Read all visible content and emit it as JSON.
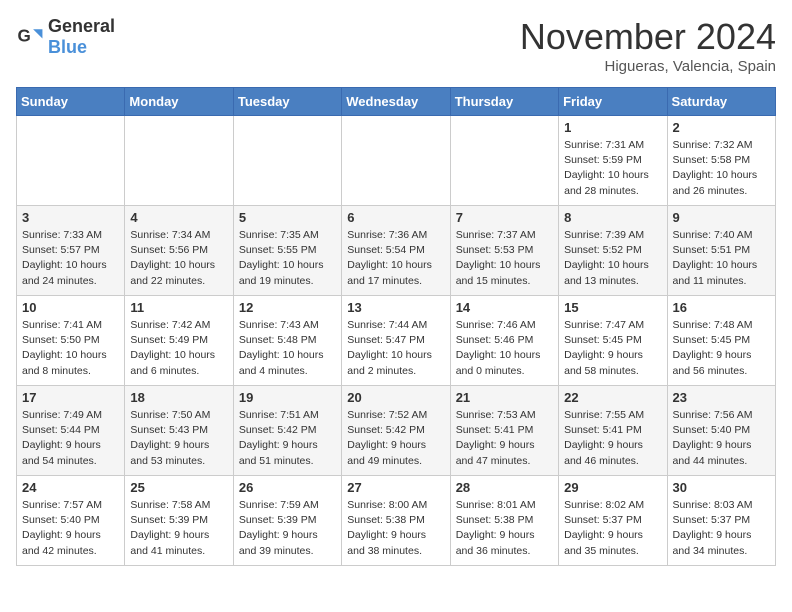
{
  "header": {
    "logo_general": "General",
    "logo_blue": "Blue",
    "month_title": "November 2024",
    "location": "Higueras, Valencia, Spain"
  },
  "days_of_week": [
    "Sunday",
    "Monday",
    "Tuesday",
    "Wednesday",
    "Thursday",
    "Friday",
    "Saturday"
  ],
  "weeks": [
    [
      {
        "day": "",
        "info": ""
      },
      {
        "day": "",
        "info": ""
      },
      {
        "day": "",
        "info": ""
      },
      {
        "day": "",
        "info": ""
      },
      {
        "day": "",
        "info": ""
      },
      {
        "day": "1",
        "info": "Sunrise: 7:31 AM\nSunset: 5:59 PM\nDaylight: 10 hours and 28 minutes."
      },
      {
        "day": "2",
        "info": "Sunrise: 7:32 AM\nSunset: 5:58 PM\nDaylight: 10 hours and 26 minutes."
      }
    ],
    [
      {
        "day": "3",
        "info": "Sunrise: 7:33 AM\nSunset: 5:57 PM\nDaylight: 10 hours and 24 minutes."
      },
      {
        "day": "4",
        "info": "Sunrise: 7:34 AM\nSunset: 5:56 PM\nDaylight: 10 hours and 22 minutes."
      },
      {
        "day": "5",
        "info": "Sunrise: 7:35 AM\nSunset: 5:55 PM\nDaylight: 10 hours and 19 minutes."
      },
      {
        "day": "6",
        "info": "Sunrise: 7:36 AM\nSunset: 5:54 PM\nDaylight: 10 hours and 17 minutes."
      },
      {
        "day": "7",
        "info": "Sunrise: 7:37 AM\nSunset: 5:53 PM\nDaylight: 10 hours and 15 minutes."
      },
      {
        "day": "8",
        "info": "Sunrise: 7:39 AM\nSunset: 5:52 PM\nDaylight: 10 hours and 13 minutes."
      },
      {
        "day": "9",
        "info": "Sunrise: 7:40 AM\nSunset: 5:51 PM\nDaylight: 10 hours and 11 minutes."
      }
    ],
    [
      {
        "day": "10",
        "info": "Sunrise: 7:41 AM\nSunset: 5:50 PM\nDaylight: 10 hours and 8 minutes."
      },
      {
        "day": "11",
        "info": "Sunrise: 7:42 AM\nSunset: 5:49 PM\nDaylight: 10 hours and 6 minutes."
      },
      {
        "day": "12",
        "info": "Sunrise: 7:43 AM\nSunset: 5:48 PM\nDaylight: 10 hours and 4 minutes."
      },
      {
        "day": "13",
        "info": "Sunrise: 7:44 AM\nSunset: 5:47 PM\nDaylight: 10 hours and 2 minutes."
      },
      {
        "day": "14",
        "info": "Sunrise: 7:46 AM\nSunset: 5:46 PM\nDaylight: 10 hours and 0 minutes."
      },
      {
        "day": "15",
        "info": "Sunrise: 7:47 AM\nSunset: 5:45 PM\nDaylight: 9 hours and 58 minutes."
      },
      {
        "day": "16",
        "info": "Sunrise: 7:48 AM\nSunset: 5:45 PM\nDaylight: 9 hours and 56 minutes."
      }
    ],
    [
      {
        "day": "17",
        "info": "Sunrise: 7:49 AM\nSunset: 5:44 PM\nDaylight: 9 hours and 54 minutes."
      },
      {
        "day": "18",
        "info": "Sunrise: 7:50 AM\nSunset: 5:43 PM\nDaylight: 9 hours and 53 minutes."
      },
      {
        "day": "19",
        "info": "Sunrise: 7:51 AM\nSunset: 5:42 PM\nDaylight: 9 hours and 51 minutes."
      },
      {
        "day": "20",
        "info": "Sunrise: 7:52 AM\nSunset: 5:42 PM\nDaylight: 9 hours and 49 minutes."
      },
      {
        "day": "21",
        "info": "Sunrise: 7:53 AM\nSunset: 5:41 PM\nDaylight: 9 hours and 47 minutes."
      },
      {
        "day": "22",
        "info": "Sunrise: 7:55 AM\nSunset: 5:41 PM\nDaylight: 9 hours and 46 minutes."
      },
      {
        "day": "23",
        "info": "Sunrise: 7:56 AM\nSunset: 5:40 PM\nDaylight: 9 hours and 44 minutes."
      }
    ],
    [
      {
        "day": "24",
        "info": "Sunrise: 7:57 AM\nSunset: 5:40 PM\nDaylight: 9 hours and 42 minutes."
      },
      {
        "day": "25",
        "info": "Sunrise: 7:58 AM\nSunset: 5:39 PM\nDaylight: 9 hours and 41 minutes."
      },
      {
        "day": "26",
        "info": "Sunrise: 7:59 AM\nSunset: 5:39 PM\nDaylight: 9 hours and 39 minutes."
      },
      {
        "day": "27",
        "info": "Sunrise: 8:00 AM\nSunset: 5:38 PM\nDaylight: 9 hours and 38 minutes."
      },
      {
        "day": "28",
        "info": "Sunrise: 8:01 AM\nSunset: 5:38 PM\nDaylight: 9 hours and 36 minutes."
      },
      {
        "day": "29",
        "info": "Sunrise: 8:02 AM\nSunset: 5:37 PM\nDaylight: 9 hours and 35 minutes."
      },
      {
        "day": "30",
        "info": "Sunrise: 8:03 AM\nSunset: 5:37 PM\nDaylight: 9 hours and 34 minutes."
      }
    ]
  ]
}
